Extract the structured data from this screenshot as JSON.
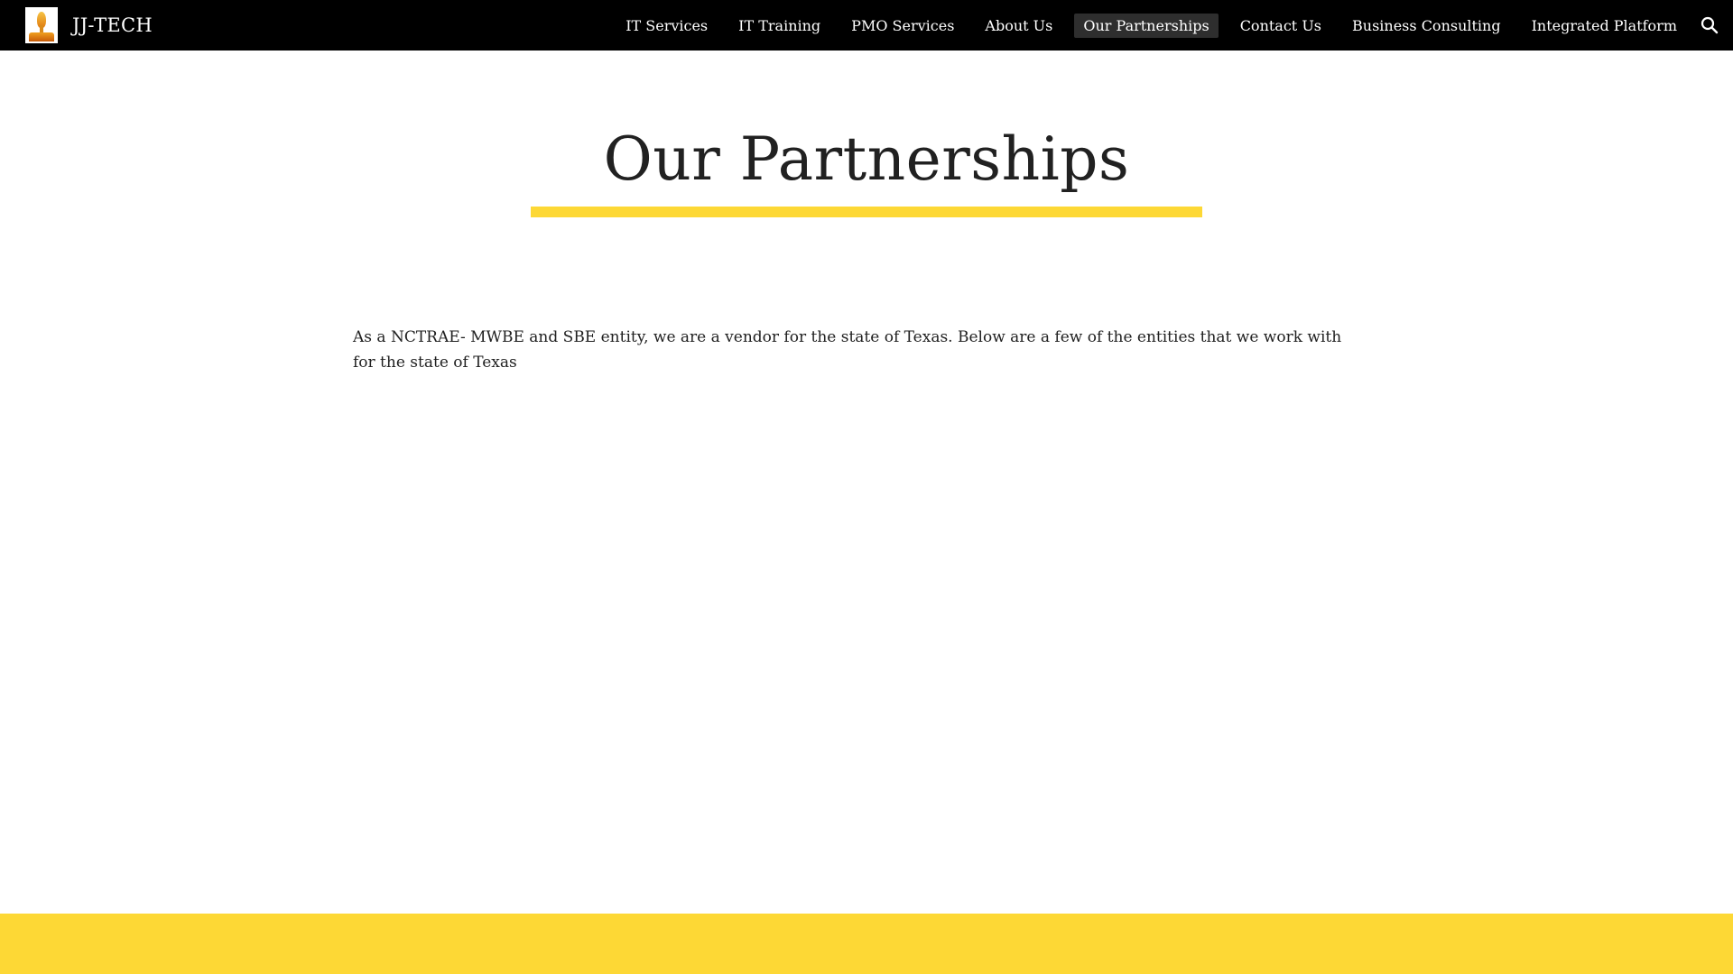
{
  "header": {
    "site_name": "JJ-TECH",
    "logo_icon": "torch-logo-icon",
    "nav": [
      {
        "label": "IT Services"
      },
      {
        "label": "IT Training"
      },
      {
        "label": "PMO Services"
      },
      {
        "label": "About Us"
      },
      {
        "label": "Our Partnerships",
        "active": true
      },
      {
        "label": "Contact Us"
      },
      {
        "label": "Business Consulting"
      },
      {
        "label": "Integrated Platform"
      }
    ],
    "search_icon": "search-icon"
  },
  "main": {
    "title": "Our Partnerships",
    "paragraph": "As a NCTRAE- MWBE and SBE entity, we are a vendor for the state of Texas. Below are a few of the entities that we work with for the state of Texas"
  },
  "colors": {
    "topbar": "#000000",
    "accent": "#fdd835",
    "text": "#212121",
    "active_nav_bg": "#2e2e2e"
  }
}
